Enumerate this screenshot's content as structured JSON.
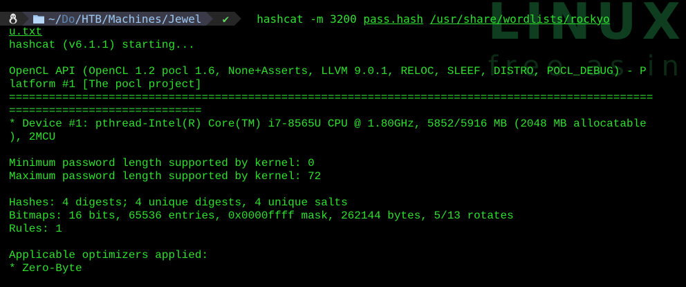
{
  "watermark": {
    "logo": "LINUX",
    "tagline": "free as in"
  },
  "prompt": {
    "path": "~/Do/HTB/Machines/Jewel",
    "path_prefix": "~/",
    "path_dim": "Do",
    "path_rest": "/HTB/Machines/Jewel",
    "status_glyph": "✔",
    "command": "hashcat -m 3200 ",
    "arg1": "pass.hash",
    "space": " ",
    "arg2": "/usr/share/wordlists/rockyo"
  },
  "terminal": {
    "lines": [
      "u.txt",
      "hashcat (v6.1.1) starting...",
      "",
      "OpenCL API (OpenCL 1.2 pocl 1.6, None+Asserts, LLVM 9.0.1, RELOC, SLEEF, DISTRO, POCL_DEBUG) - P",
      "latform #1 [The pocl project]",
      "=================================================================================================",
      "=============================",
      "* Device #1: pthread-Intel(R) Core(TM) i7-8565U CPU @ 1.80GHz, 5852/5916 MB (2048 MB allocatable",
      "), 2MCU",
      "",
      "Minimum password length supported by kernel: 0",
      "Maximum password length supported by kernel: 72",
      "",
      "Hashes: 4 digests; 4 unique digests, 4 unique salts",
      "Bitmaps: 16 bits, 65536 entries, 0x0000ffff mask, 262144 bytes, 5/13 rotates",
      "Rules: 1",
      "",
      "Applicable optimizers applied:",
      "* Zero-Byte"
    ]
  },
  "colors": {
    "background": "#000000",
    "text": "#2fe02f",
    "prompt_dir_bg": "#3a3a48",
    "prompt_os_bg": "#2a2a2a",
    "prompt_status_bg": "#262626"
  }
}
